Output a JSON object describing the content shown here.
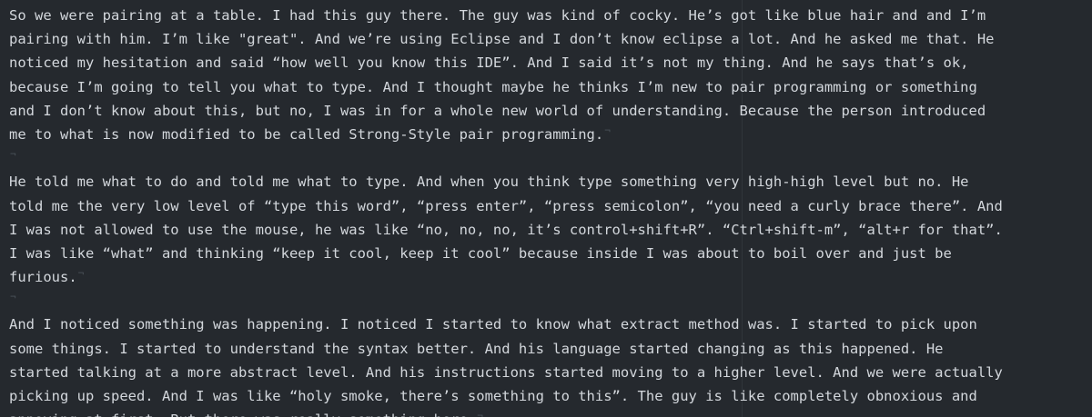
{
  "editor": {
    "eol_marker": "¬",
    "lines": [
      {
        "text": "So we were pairing at a table. I had this guy there. The guy was kind of cocky. He’s got like blue hair and and I’m",
        "eol": false
      },
      {
        "text": "pairing with him. I’m like \"great\". And we’re using Eclipse and I don’t know eclipse a lot. And he asked me that. He",
        "eol": false
      },
      {
        "text": "noticed my hesitation and said “how well you know this IDE”. And I said it’s not my thing. And he says that’s ok,",
        "eol": false
      },
      {
        "text": "because I’m going to tell you what to type. And I thought maybe he thinks I’m new to pair programming or something",
        "eol": false
      },
      {
        "text": "and I don’t know about this, but no, I was in for a whole new world of understanding. Because the person introduced",
        "eol": false
      },
      {
        "text": "me to what is now modified to be called Strong-Style pair programming.",
        "eol": true
      },
      {
        "text": "",
        "eol": true
      },
      {
        "text": "He told me what to do and told me what to type. And when you think type something very high-high level but no. He",
        "eol": false
      },
      {
        "text": "told me the very low level of “type this word”, “press enter”, “press semicolon”, “you need a curly brace there”. And",
        "eol": false
      },
      {
        "text": "I was not allowed to use the mouse, he was like “no, no, no, it’s control+shift+R”. “Ctrl+shift-m”, “alt+r for that”.",
        "eol": false
      },
      {
        "text": "I was like “what” and thinking “keep it cool, keep it cool” because inside I was about to boil over and just be",
        "eol": false
      },
      {
        "text": "furious.",
        "eol": true
      },
      {
        "text": "",
        "eol": true
      },
      {
        "text": "And I noticed something was happening. I noticed I started to know what extract method was. I started to pick upon",
        "eol": false
      },
      {
        "text": "some things. I started to understand the syntax better. And his language started changing as this happened. He",
        "eol": false
      },
      {
        "text": "started talking at a more abstract level. And his instructions started moving to a higher level. And we were actually",
        "eol": false
      },
      {
        "text": "picking up speed. And I was like “holy smoke, there’s something to this”. The guy is like completely obnoxious and",
        "eol": false
      },
      {
        "text": "annoying at first. But there was really something here.",
        "eol": true
      }
    ]
  }
}
